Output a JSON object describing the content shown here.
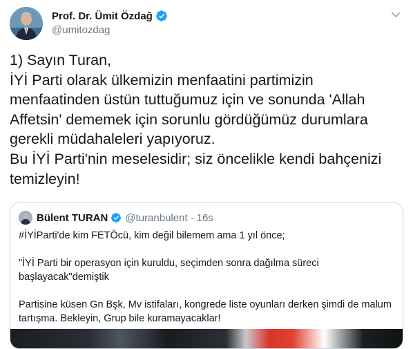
{
  "tweet": {
    "display_name": "Prof. Dr. Ümit Özdağ",
    "handle": "@umitozdag",
    "lines": [
      "1) Sayın Turan,",
      "İYİ Parti olarak ülkemizin menfaatini partimizin",
      "menfaatinden üstün tuttuğumuz için ve sonunda 'Allah",
      "Affetsin' dememek için sorunlu gördüğümüz durumlara",
      "gerekli müdahaleleri yapıyoruz.",
      "Bu İYİ Parti'nin meselesidir; siz öncelikle kendi bahçenizi",
      "temizleyin!"
    ]
  },
  "quoted": {
    "display_name": "Bülent TURAN",
    "handle": "@turanbulent",
    "separator": "·",
    "time": "16s",
    "paragraphs": [
      "#İYİParti'de kim FETÖcü, kim değil bilemem ama 1 yıl önce;",
      "\"İYİ Parti bir operasyon için kuruldu, seçimden sonra dağılma süreci başlayacak\"demiştik",
      "Partisine küsen Gn Bşk, Mv istifaları, kongrede liste oyunları derken şimdi de malum tartışma. Bekleyin, Grup bile kuramayacaklar!"
    ]
  },
  "icons": {
    "verified": "verified-badge-icon",
    "menu": "chevron-down-icon"
  },
  "colors": {
    "verified_blue": "#1da1f2",
    "secondary_text": "#657786",
    "border": "#ccd6dd"
  }
}
